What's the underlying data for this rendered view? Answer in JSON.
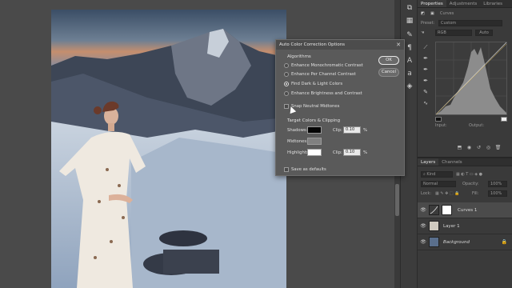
{
  "dialog": {
    "title": "Auto Color Correction Options",
    "algorithms_label": "Algorithms",
    "algorithms": [
      {
        "label": "Enhance Monochromatic Contrast",
        "selected": false
      },
      {
        "label": "Enhance Per Channel Contrast",
        "selected": false
      },
      {
        "label": "Find Dark & Light Colors",
        "selected": true
      },
      {
        "label": "Enhance Brightness and Contrast",
        "selected": false
      }
    ],
    "snap_neutral_midtones": {
      "label": "Snap Neutral Midtones",
      "checked": false
    },
    "target_label": "Target Colors & Clipping",
    "targets": [
      {
        "label": "Shadows:",
        "color": "#050505",
        "clip_label": "Clip:",
        "clip_value": "0.10",
        "unit": "%"
      },
      {
        "label": "Midtones:",
        "color": "#808080"
      },
      {
        "label": "Highlights:",
        "color": "#ffffff",
        "clip_label": "Clip:",
        "clip_value": "0.10",
        "unit": "%"
      }
    ],
    "save_defaults_label": "Save as defaults",
    "ok_label": "OK",
    "cancel_label": "Cancel",
    "close_icon": "close-icon"
  },
  "properties_panel": {
    "tabs": [
      "Properties",
      "Adjustments",
      "Libraries"
    ],
    "adjustment_name": "Curves",
    "preset_label": "Preset:",
    "preset_value": "Custom",
    "channel_value": "RGB",
    "auto_label": "Auto",
    "input_label": "Input:",
    "output_label": "Output:"
  },
  "layers_panel": {
    "tabs": [
      "Layers",
      "Channels"
    ],
    "kind_label": "Kind",
    "blend_mode": "Normal",
    "opacity_label": "Opacity:",
    "opacity_value": "100%",
    "lock_label": "Lock:",
    "fill_label": "Fill:",
    "fill_value": "100%",
    "layers": [
      {
        "name": "Curves 1",
        "selected": true
      },
      {
        "name": "Layer 1",
        "selected": false
      },
      {
        "name": "Background",
        "selected": false,
        "locked": true
      }
    ]
  },
  "colors": {
    "dialog_bg": "#5a5a5a",
    "panel_bg": "#3a3a3a",
    "canvas_bg": "#4a4a4a"
  }
}
